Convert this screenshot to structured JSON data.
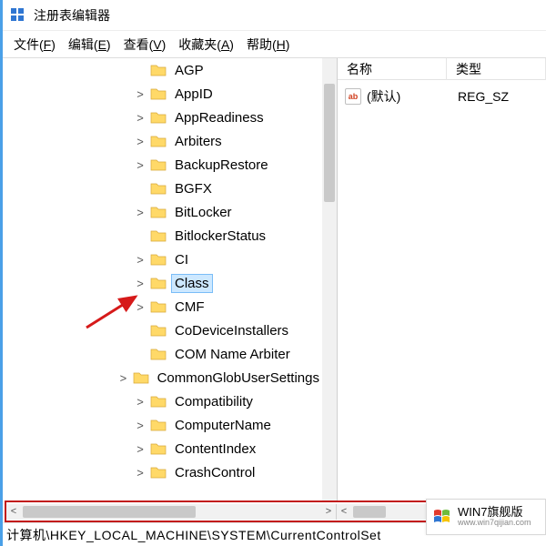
{
  "window": {
    "title": "注册表编辑器"
  },
  "menu": {
    "items": [
      {
        "label": "文件",
        "accel": "F"
      },
      {
        "label": "编辑",
        "accel": "E"
      },
      {
        "label": "查看",
        "accel": "V"
      },
      {
        "label": "收藏夹",
        "accel": "A"
      },
      {
        "label": "帮助",
        "accel": "H"
      }
    ]
  },
  "tree": {
    "items": [
      {
        "label": "AGP",
        "expander": "",
        "selected": false
      },
      {
        "label": "AppID",
        "expander": ">",
        "selected": false
      },
      {
        "label": "AppReadiness",
        "expander": ">",
        "selected": false
      },
      {
        "label": "Arbiters",
        "expander": ">",
        "selected": false
      },
      {
        "label": "BackupRestore",
        "expander": ">",
        "selected": false
      },
      {
        "label": "BGFX",
        "expander": "",
        "selected": false
      },
      {
        "label": "BitLocker",
        "expander": ">",
        "selected": false
      },
      {
        "label": "BitlockerStatus",
        "expander": "",
        "selected": false
      },
      {
        "label": "CI",
        "expander": ">",
        "selected": false
      },
      {
        "label": "Class",
        "expander": ">",
        "selected": true
      },
      {
        "label": "CMF",
        "expander": ">",
        "selected": false
      },
      {
        "label": "CoDeviceInstallers",
        "expander": "",
        "selected": false
      },
      {
        "label": "COM Name Arbiter",
        "expander": "",
        "selected": false
      },
      {
        "label": "CommonGlobUserSettings",
        "expander": ">",
        "selected": false
      },
      {
        "label": "Compatibility",
        "expander": ">",
        "selected": false
      },
      {
        "label": "ComputerName",
        "expander": ">",
        "selected": false
      },
      {
        "label": "ContentIndex",
        "expander": ">",
        "selected": false
      },
      {
        "label": "CrashControl",
        "expander": ">",
        "selected": false
      }
    ]
  },
  "list": {
    "columns": {
      "name": "名称",
      "type": "类型"
    },
    "rows": [
      {
        "icon": "string-value-icon",
        "name": "(默认)",
        "type": "REG_SZ"
      }
    ]
  },
  "scroll": {
    "left_arrow": "<",
    "right_arrow": ">"
  },
  "status": {
    "path": "计算机\\HKEY_LOCAL_MACHINE\\SYSTEM\\CurrentControlSet"
  },
  "watermark": {
    "main": "WIN7旗舰版",
    "sub": "www.win7qijian.com"
  }
}
